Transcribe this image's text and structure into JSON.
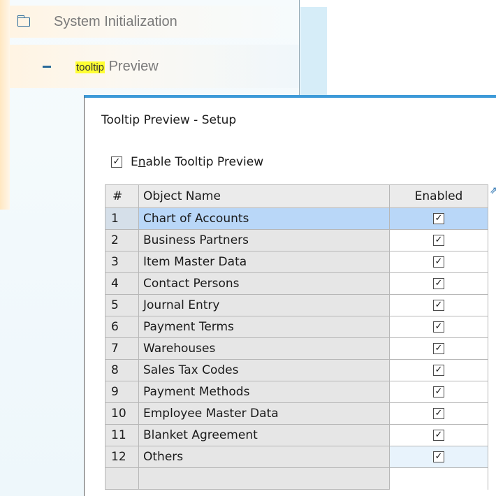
{
  "tree": {
    "item1": {
      "label": "System Initialization"
    },
    "item2": {
      "highlight": "tooltip",
      "label_rest": " Preview"
    }
  },
  "dialog": {
    "title": "Tooltip Preview - Setup",
    "enable_checkbox": {
      "checked": true,
      "label_pre": "E",
      "label_u": "n",
      "label_post": "able Tooltip Preview"
    },
    "table": {
      "columns": [
        "#",
        "Object Name",
        "Enabled"
      ],
      "rows": [
        {
          "num": "1",
          "name": "Chart of Accounts",
          "enabled": true
        },
        {
          "num": "2",
          "name": "Business Partners",
          "enabled": true
        },
        {
          "num": "3",
          "name": "Item Master Data",
          "enabled": true
        },
        {
          "num": "4",
          "name": "Contact Persons",
          "enabled": true
        },
        {
          "num": "5",
          "name": "Journal Entry",
          "enabled": true
        },
        {
          "num": "6",
          "name": "Payment Terms",
          "enabled": true
        },
        {
          "num": "7",
          "name": "Warehouses",
          "enabled": true
        },
        {
          "num": "8",
          "name": "Sales Tax Codes",
          "enabled": true
        },
        {
          "num": "9",
          "name": "Payment Methods",
          "enabled": true
        },
        {
          "num": "10",
          "name": "Employee Master Data",
          "enabled": true
        },
        {
          "num": "11",
          "name": "Blanket Agreement",
          "enabled": true
        },
        {
          "num": "12",
          "name": "Others",
          "enabled": true
        }
      ],
      "selected_row": 1
    }
  },
  "icons": {
    "folder": "folder-icon",
    "collapse": "dash-icon",
    "check": "✓",
    "expand": "expand-icon"
  },
  "colors": {
    "accent": "#3d9ad8",
    "selection": "#b9d7f8",
    "highlight": "#ffff33"
  }
}
